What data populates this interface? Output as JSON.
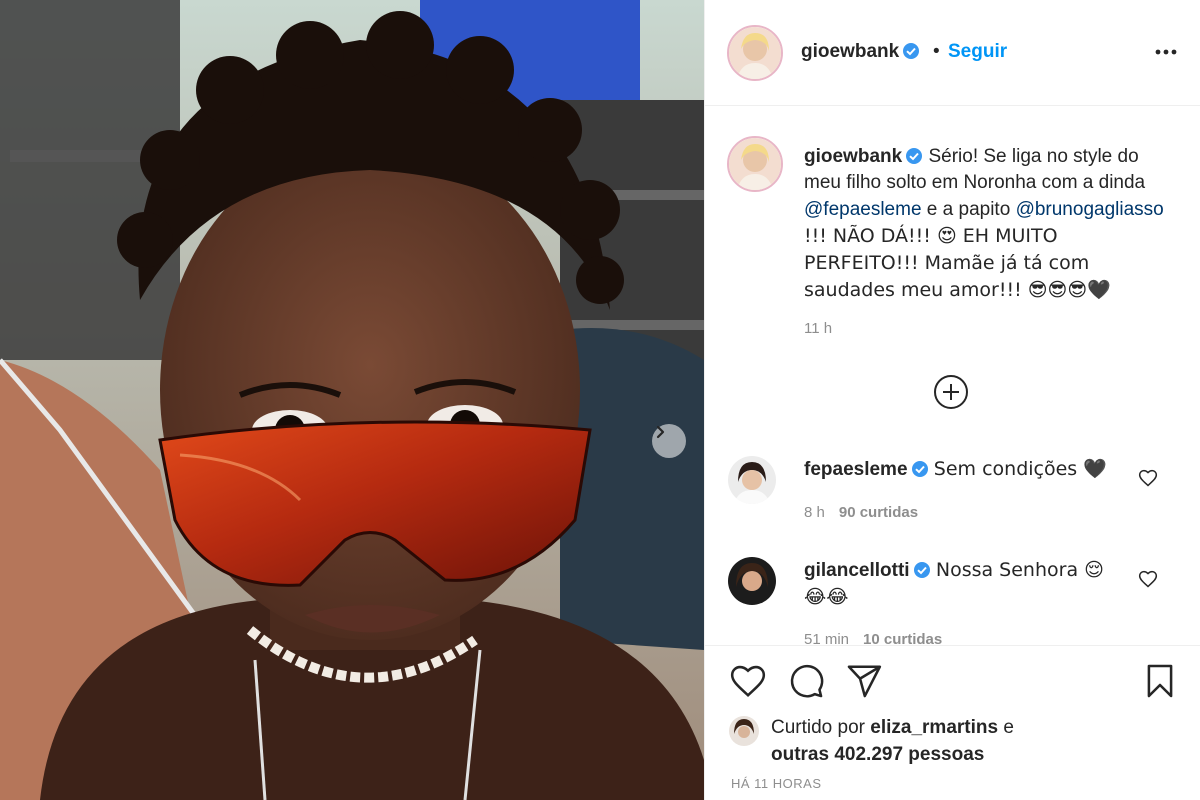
{
  "post": {
    "author": "gioewbank",
    "follow_label": "Seguir",
    "separator": "•",
    "caption": {
      "part1": "Sério! Se liga no style do meu filho solto em Noronha com a dinda ",
      "mention1": "@fepaesleme",
      "part2": " e a papito ",
      "mention2": "@brunogagliasso",
      "part3": " !!! NÃO DÁ!!! 😍 EH MUITO PERFEITO!!! Mamãe já tá com saudades meu amor!!! 😎😎😎🖤"
    },
    "caption_time": "11 h",
    "liked_by_prefix": "Curtido por ",
    "liked_by_user": "eliza_rmartins",
    "liked_by_mid": " e ",
    "liked_by_others": "outras 402.297 pessoas",
    "post_time": "HÁ 11 HORAS"
  },
  "comments": [
    {
      "user": "fepaesleme",
      "text": "Sem condições 🖤",
      "time": "8 h",
      "likes": "90 curtidas"
    },
    {
      "user": "gilancellotti",
      "text": "Nossa Senhora 😌😂😂",
      "time": "51 min",
      "likes": "10 curtidas"
    }
  ],
  "icons": {
    "verified": "verified-badge-icon",
    "more": "more-options-icon",
    "load_more": "plus-circle-icon",
    "like": "heart-icon",
    "comment": "comment-icon",
    "share": "paper-plane-icon",
    "save": "bookmark-icon",
    "next": "chevron-right-icon"
  },
  "colors": {
    "accent": "#0095f6",
    "verified": "#3897f0",
    "muted": "#8e8e8e",
    "border": "#efefef"
  }
}
